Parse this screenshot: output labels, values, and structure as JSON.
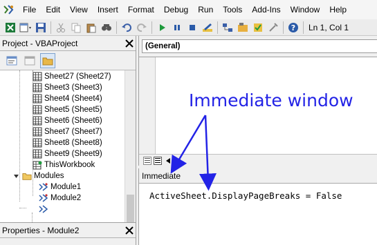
{
  "menubar": {
    "items": [
      "File",
      "Edit",
      "View",
      "Insert",
      "Format",
      "Debug",
      "Run",
      "Tools",
      "Add-Ins",
      "Window",
      "Help"
    ]
  },
  "toolbar": {
    "position_label": "Ln 1, Col 1"
  },
  "project": {
    "title": "Project - VBAProject",
    "tree": [
      "Sheet27 (Sheet27)",
      "Sheet3 (Sheet3)",
      "Sheet4 (Sheet4)",
      "Sheet5 (Sheet5)",
      "Sheet6 (Sheet6)",
      "Sheet7 (Sheet7)",
      "Sheet8 (Sheet8)",
      "Sheet9 (Sheet9)",
      "ThisWorkbook",
      "Modules",
      "Module1",
      "Module2"
    ]
  },
  "properties": {
    "title": "Properties - Module2"
  },
  "code": {
    "object_combo": "(General)"
  },
  "immediate": {
    "title": "Immediate",
    "code_line": "ActiveSheet.DisplayPageBreaks = False"
  },
  "annotation": {
    "text": "Immediate window",
    "color": "#2323e6"
  }
}
